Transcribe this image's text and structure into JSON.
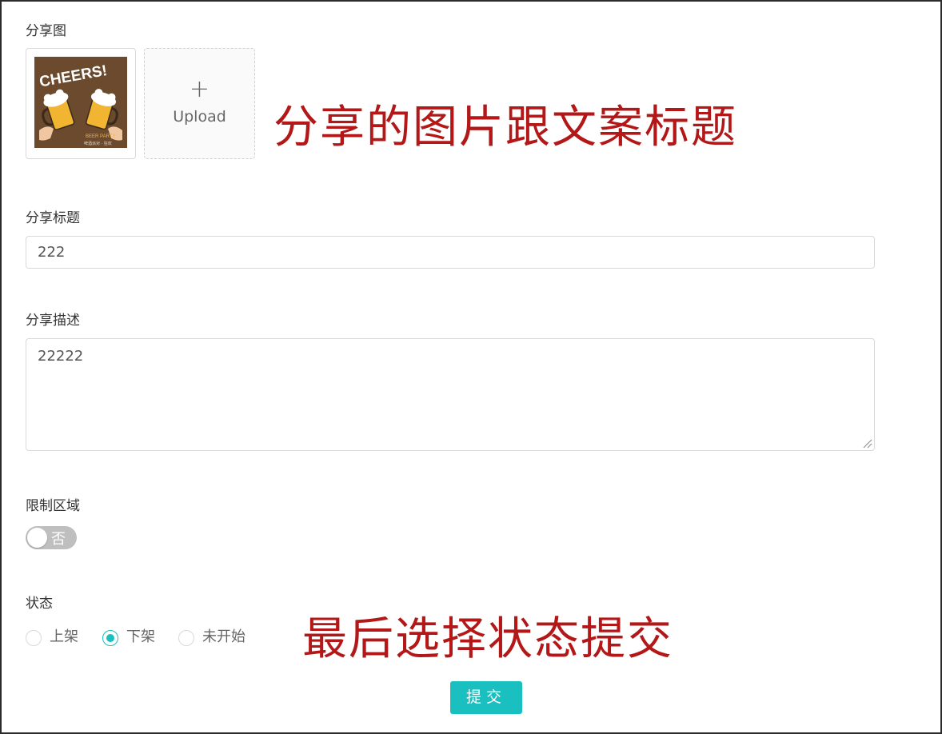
{
  "share_image": {
    "label": "分享图",
    "thumbnail": {
      "headline": "CHEERS!",
      "caption_line1": "BEER PARTY",
      "caption_line2": "啤酒派对 · 狂欢"
    },
    "upload_label": "Upload"
  },
  "annotations": {
    "top": "分享的图片跟文案标题",
    "bottom": "最后选择状态提交"
  },
  "share_title": {
    "label": "分享标题",
    "value": "222"
  },
  "share_description": {
    "label": "分享描述",
    "value": "22222"
  },
  "restrict_area": {
    "label": "限制区域",
    "switch_text": "否",
    "enabled": false
  },
  "status": {
    "label": "状态",
    "options": [
      "上架",
      "下架",
      "未开始"
    ],
    "selected": "下架"
  },
  "submit_label": "提交",
  "colors": {
    "accent": "#1abfbf",
    "annotation": "#b31717",
    "thumbnail_bg": "#6b4a2e"
  }
}
